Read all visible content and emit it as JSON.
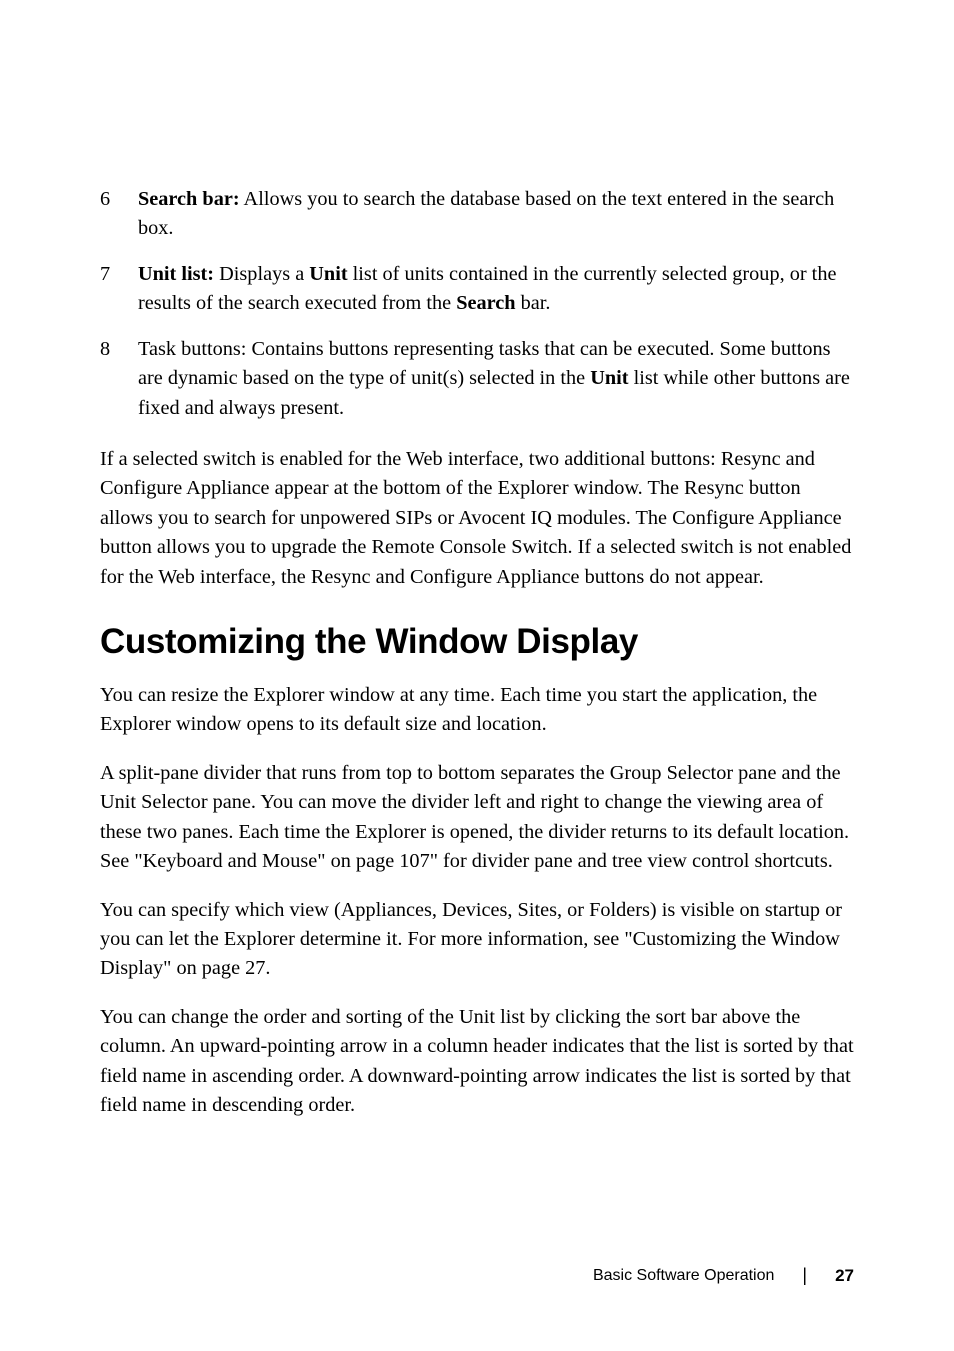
{
  "list": {
    "item6": {
      "num": "6",
      "label": "Search bar:",
      "text": " Allows you to search the database based on the text entered in the search box."
    },
    "item7": {
      "num": "7",
      "label": "Unit list:",
      "t1": " Displays a ",
      "b1": "Unit",
      "t2": " list of units contained in the currently selected group, or the results of the search executed from the ",
      "b2": "Search",
      "t3": " bar."
    },
    "item8": {
      "num": "8",
      "t1": "Task buttons: Contains buttons representing tasks that can be executed. Some buttons are dynamic based on the type of unit(s) selected in the ",
      "b1": "Unit",
      "t2": " list while other buttons are fixed and always present."
    }
  },
  "para1": "If a selected switch is enabled for the Web interface, two additional buttons: Resync and Configure Appliance appear at the bottom of the Explorer window. The Resync button allows you to search for unpowered SIPs or Avocent IQ modules. The Configure Appliance button allows you to upgrade the Remote Console Switch. If a selected switch is not enabled for the Web interface, the Resync and Configure Appliance buttons do not appear.",
  "heading": "Customizing the Window Display",
  "para2": "You can resize the Explorer window at any time. Each time you start the application, the Explorer window opens to its default size and location.",
  "para3": "A split-pane divider that runs from top to bottom separates the Group Selector pane and the Unit Selector pane. You can move the divider left and right to change the viewing area of these two panes. Each time the Explorer is opened, the divider returns to its default location. See \"Keyboard and Mouse\" on page 107\" for divider pane and tree view control shortcuts.",
  "para4": "You can specify which view (Appliances, Devices, Sites, or Folders) is visible on startup or you can let the Explorer determine it. For more information, see \"Customizing the Window Display\" on page 27.",
  "para5": "You can change the order and sorting of the Unit list by clicking the sort bar above the column. An upward-pointing arrow in a column header indicates that the list is sorted by that field name in ascending order. A downward-pointing arrow indicates the list is sorted by that field name in descending order.",
  "footer": {
    "section": "Basic Software Operation",
    "divider": "|",
    "page": "27"
  }
}
